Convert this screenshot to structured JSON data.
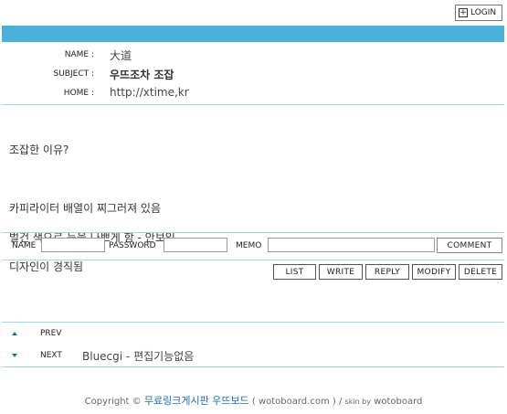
{
  "header": {
    "login_label": "LOGIN"
  },
  "post": {
    "name_label": "NAME :",
    "name_value": "大道",
    "subject_label": "SUBJECT :",
    "subject_value": "우뜨조차 조잡",
    "home_label": "HOME :",
    "home_value": "http://xtime,kr",
    "content_lines": [
      "조잡한 이유?",
      "",
      "카피라이터 배열이 찌그러져 있음",
      "벌건 색으로 눈을 나쁘게 함 - 안보임",
      "디자인이 경직됨"
    ]
  },
  "comment_form": {
    "name_label": "NAME",
    "password_label": "PASSWORD",
    "memo_label": "MEMO",
    "submit_label": "COMMENT"
  },
  "actions": {
    "list": "LIST",
    "write": "WRITE",
    "reply": "REPLY",
    "modify": "MODIFY",
    "delete": "DELETE"
  },
  "nav": {
    "prev_label": "PREV",
    "next_label": "NEXT",
    "next_title": "Bluecgi - 편집기능없음"
  },
  "footer": {
    "copyright": "Copyright ©",
    "site_name": "무료링크게시판 우뜨보드",
    "domain": "( wotoboard.com )",
    "separator": "/",
    "skin_prefix": "skin by",
    "skin_name": "wotoboard"
  },
  "colors": {
    "accent": "#4ab0d9",
    "divider": "#a6d5e6",
    "arrow": "#137a9e"
  },
  "icons": {
    "login": "plus-box-icon",
    "prev": "triangle-up-icon",
    "next": "triangle-down-icon"
  }
}
